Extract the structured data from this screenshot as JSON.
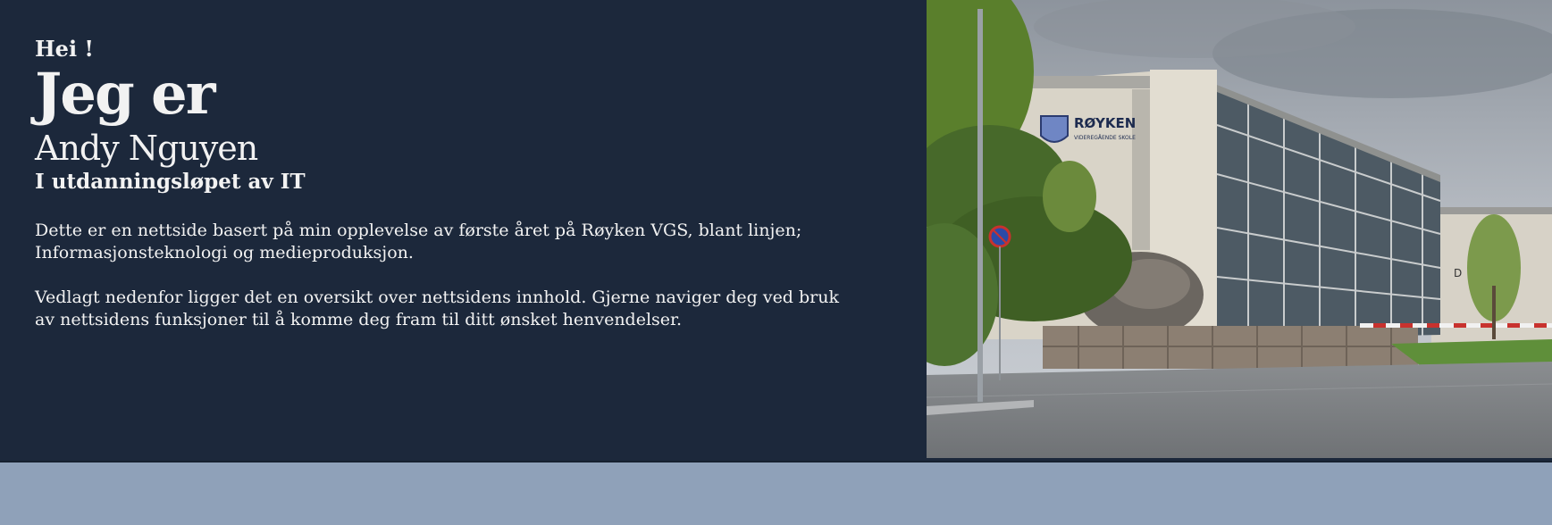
{
  "intro": {
    "greeting": "Hei !",
    "heading": "Jeg er",
    "name": "Andy Nguyen",
    "subtitle": "I utdanningsløpet av IT",
    "paragraph_1": "Dette er en nettside basert på min opplevelse av første året på Røyken VGS, blant linjen; Informasjonsteknologi og medieproduksjon.",
    "paragraph_2": "Vedlagt nedenfor ligger det en oversikt over nettsidens innhold. Gjerne naviger deg ved bruk av nettsidens funksjoner til å komme deg fram til ditt ønsket henvendelser."
  },
  "photo": {
    "sign_title": "RØYKEN",
    "sign_subtitle": "VIDEREGÅENDE SKOLE",
    "building_letter": "D"
  },
  "colors": {
    "hero_bg": "#1c283b",
    "page_bg": "#8fa1b9",
    "text": "#f2f2f2"
  }
}
